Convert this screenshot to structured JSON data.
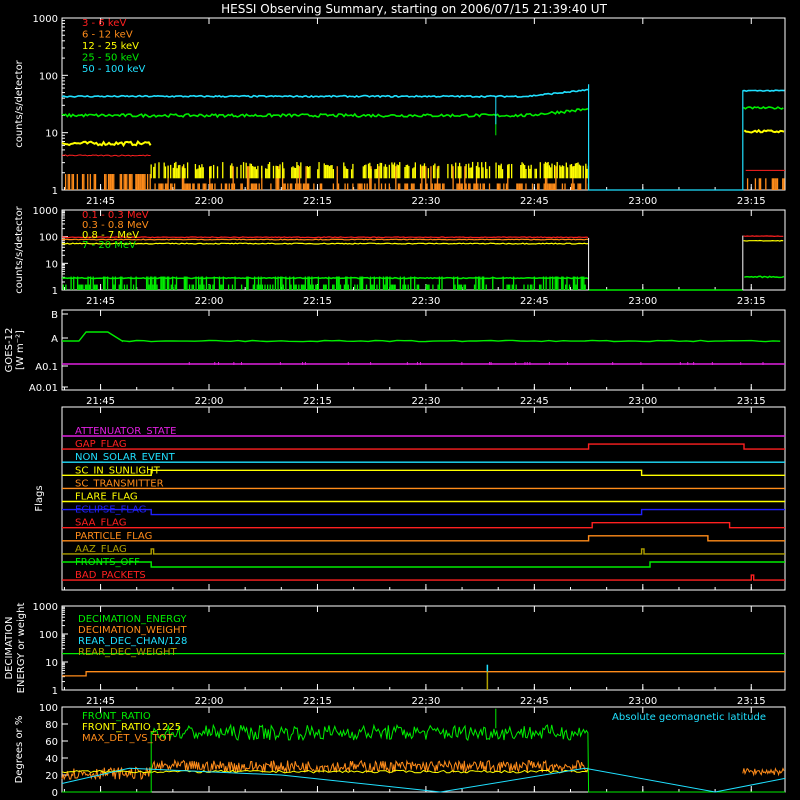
{
  "title": "HESSI Observing Summary, starting on 2006/07/15 21:39:40 UT",
  "colors": {
    "background": "#000000",
    "axes": "#ffffff",
    "red": "#ff2020",
    "orange": "#ff8c1a",
    "yellow": "#ffff00",
    "green": "#00ee00",
    "cyan": "#20e0ff",
    "magenta": "#e020e0",
    "blue": "#2020ff",
    "olive": "#b0a000"
  },
  "chart_data": [
    {
      "type": "line",
      "title": "HESSI Observing Summary, starting on 2006/07/15 21:39:40 UT",
      "ylabel": "counts/s/detector",
      "y_scale": "log",
      "ylim": [
        1,
        1000
      ],
      "yticks": [
        "1",
        "10",
        "100",
        "1000"
      ],
      "xlim": [
        "21:39:40",
        "23:19:40"
      ],
      "xticks": [
        "21:45",
        "22:00",
        "22:15",
        "22:30",
        "22:45",
        "23:00",
        "23:15"
      ],
      "series": [
        {
          "name": "3 - 6 keV",
          "color": "#ff2020"
        },
        {
          "name": "6 - 12 keV",
          "color": "#ff8c1a"
        },
        {
          "name": "12 - 25 keV",
          "color": "#ffff00"
        },
        {
          "name": "25 - 50 keV",
          "color": "#00ee00"
        },
        {
          "name": "50 - 100 keV",
          "color": "#20e0ff"
        }
      ]
    },
    {
      "type": "line",
      "ylabel": "counts/s/detector",
      "y_scale": "log",
      "ylim": [
        1,
        1000
      ],
      "yticks": [
        "1",
        "10",
        "100",
        "1000"
      ],
      "xticks": [
        "21:45",
        "22:00",
        "22:15",
        "22:30",
        "22:45",
        "23:00",
        "23:15"
      ],
      "series": [
        {
          "name": "0.1 - 0.3 MeV",
          "color": "#ff2020"
        },
        {
          "name": "0.3 - 0.8 MeV",
          "color": "#ff8c1a"
        },
        {
          "name": "0.8 - 7 MeV",
          "color": "#ffff00"
        },
        {
          "name": "7 - 20 MeV",
          "color": "#00ee00"
        }
      ]
    },
    {
      "type": "line",
      "ylabel": "GOES-12",
      "ylabel2": "[W m⁻²]",
      "yticks": [
        "B",
        "A",
        "A0.1",
        "A0.01"
      ],
      "xticks": [
        "21:45",
        "22:00",
        "22:15",
        "22:30",
        "22:45",
        "23:00",
        "23:15"
      ],
      "series": [
        {
          "color": "#00ee00"
        },
        {
          "color": "#e020e0"
        }
      ]
    },
    {
      "type": "line",
      "ylabel": "Flags",
      "series": [
        {
          "name": "ATTENUATOR_STATE",
          "color": "#e020e0"
        },
        {
          "name": "GAP_FLAG",
          "color": "#ff2020"
        },
        {
          "name": "NON_SOLAR_EVENT",
          "color": "#20e0ff"
        },
        {
          "name": "SC_IN_SUNLIGHT",
          "color": "#ffff00"
        },
        {
          "name": "SC_TRANSMITTER",
          "color": "#ff8c1a"
        },
        {
          "name": "FLARE_FLAG",
          "color": "#ffff00"
        },
        {
          "name": "ECLIPSE_FLAG",
          "color": "#2020ff"
        },
        {
          "name": "SAA_FLAG",
          "color": "#ff2020"
        },
        {
          "name": "PARTICLE_FLAG",
          "color": "#ff8c1a"
        },
        {
          "name": "AAZ_FLAG",
          "color": "#b0a000"
        },
        {
          "name": "FRONTS_OFF",
          "color": "#00ee00"
        },
        {
          "name": "BAD_PACKETS",
          "color": "#ff2020"
        }
      ]
    },
    {
      "type": "line",
      "ylabel": "DECIMATION",
      "ylabel2": "ENERGY or weight",
      "y_scale": "log",
      "ylim": [
        1,
        1000
      ],
      "yticks": [
        "1",
        "10",
        "100",
        "1000"
      ],
      "xticks": [
        "21:45",
        "22:00",
        "22:15",
        "22:30",
        "22:45",
        "23:00",
        "23:15"
      ],
      "series": [
        {
          "name": "DECIMATION_ENERGY",
          "color": "#00ee00"
        },
        {
          "name": "DECIMATION_WEIGHT",
          "color": "#ff8c1a"
        },
        {
          "name": "REAR_DEC_CHAN/128",
          "color": "#20e0ff"
        },
        {
          "name": "REAR_DEC_WEIGHT",
          "color": "#b0a000"
        }
      ]
    },
    {
      "type": "line",
      "ylabel": "Degrees or %",
      "ylim": [
        0,
        100
      ],
      "yticks": [
        "0",
        "20",
        "40",
        "60",
        "80",
        "100"
      ],
      "annotation": "Absolute geomagnetic latitude",
      "series": [
        {
          "name": "FRONT_RATIO",
          "color": "#00ee00"
        },
        {
          "name": "FRONT_RATIO_1225",
          "color": "#ffff00"
        },
        {
          "name": "MAX_DET_VS_TOT",
          "color": "#ff8c1a"
        }
      ]
    }
  ]
}
